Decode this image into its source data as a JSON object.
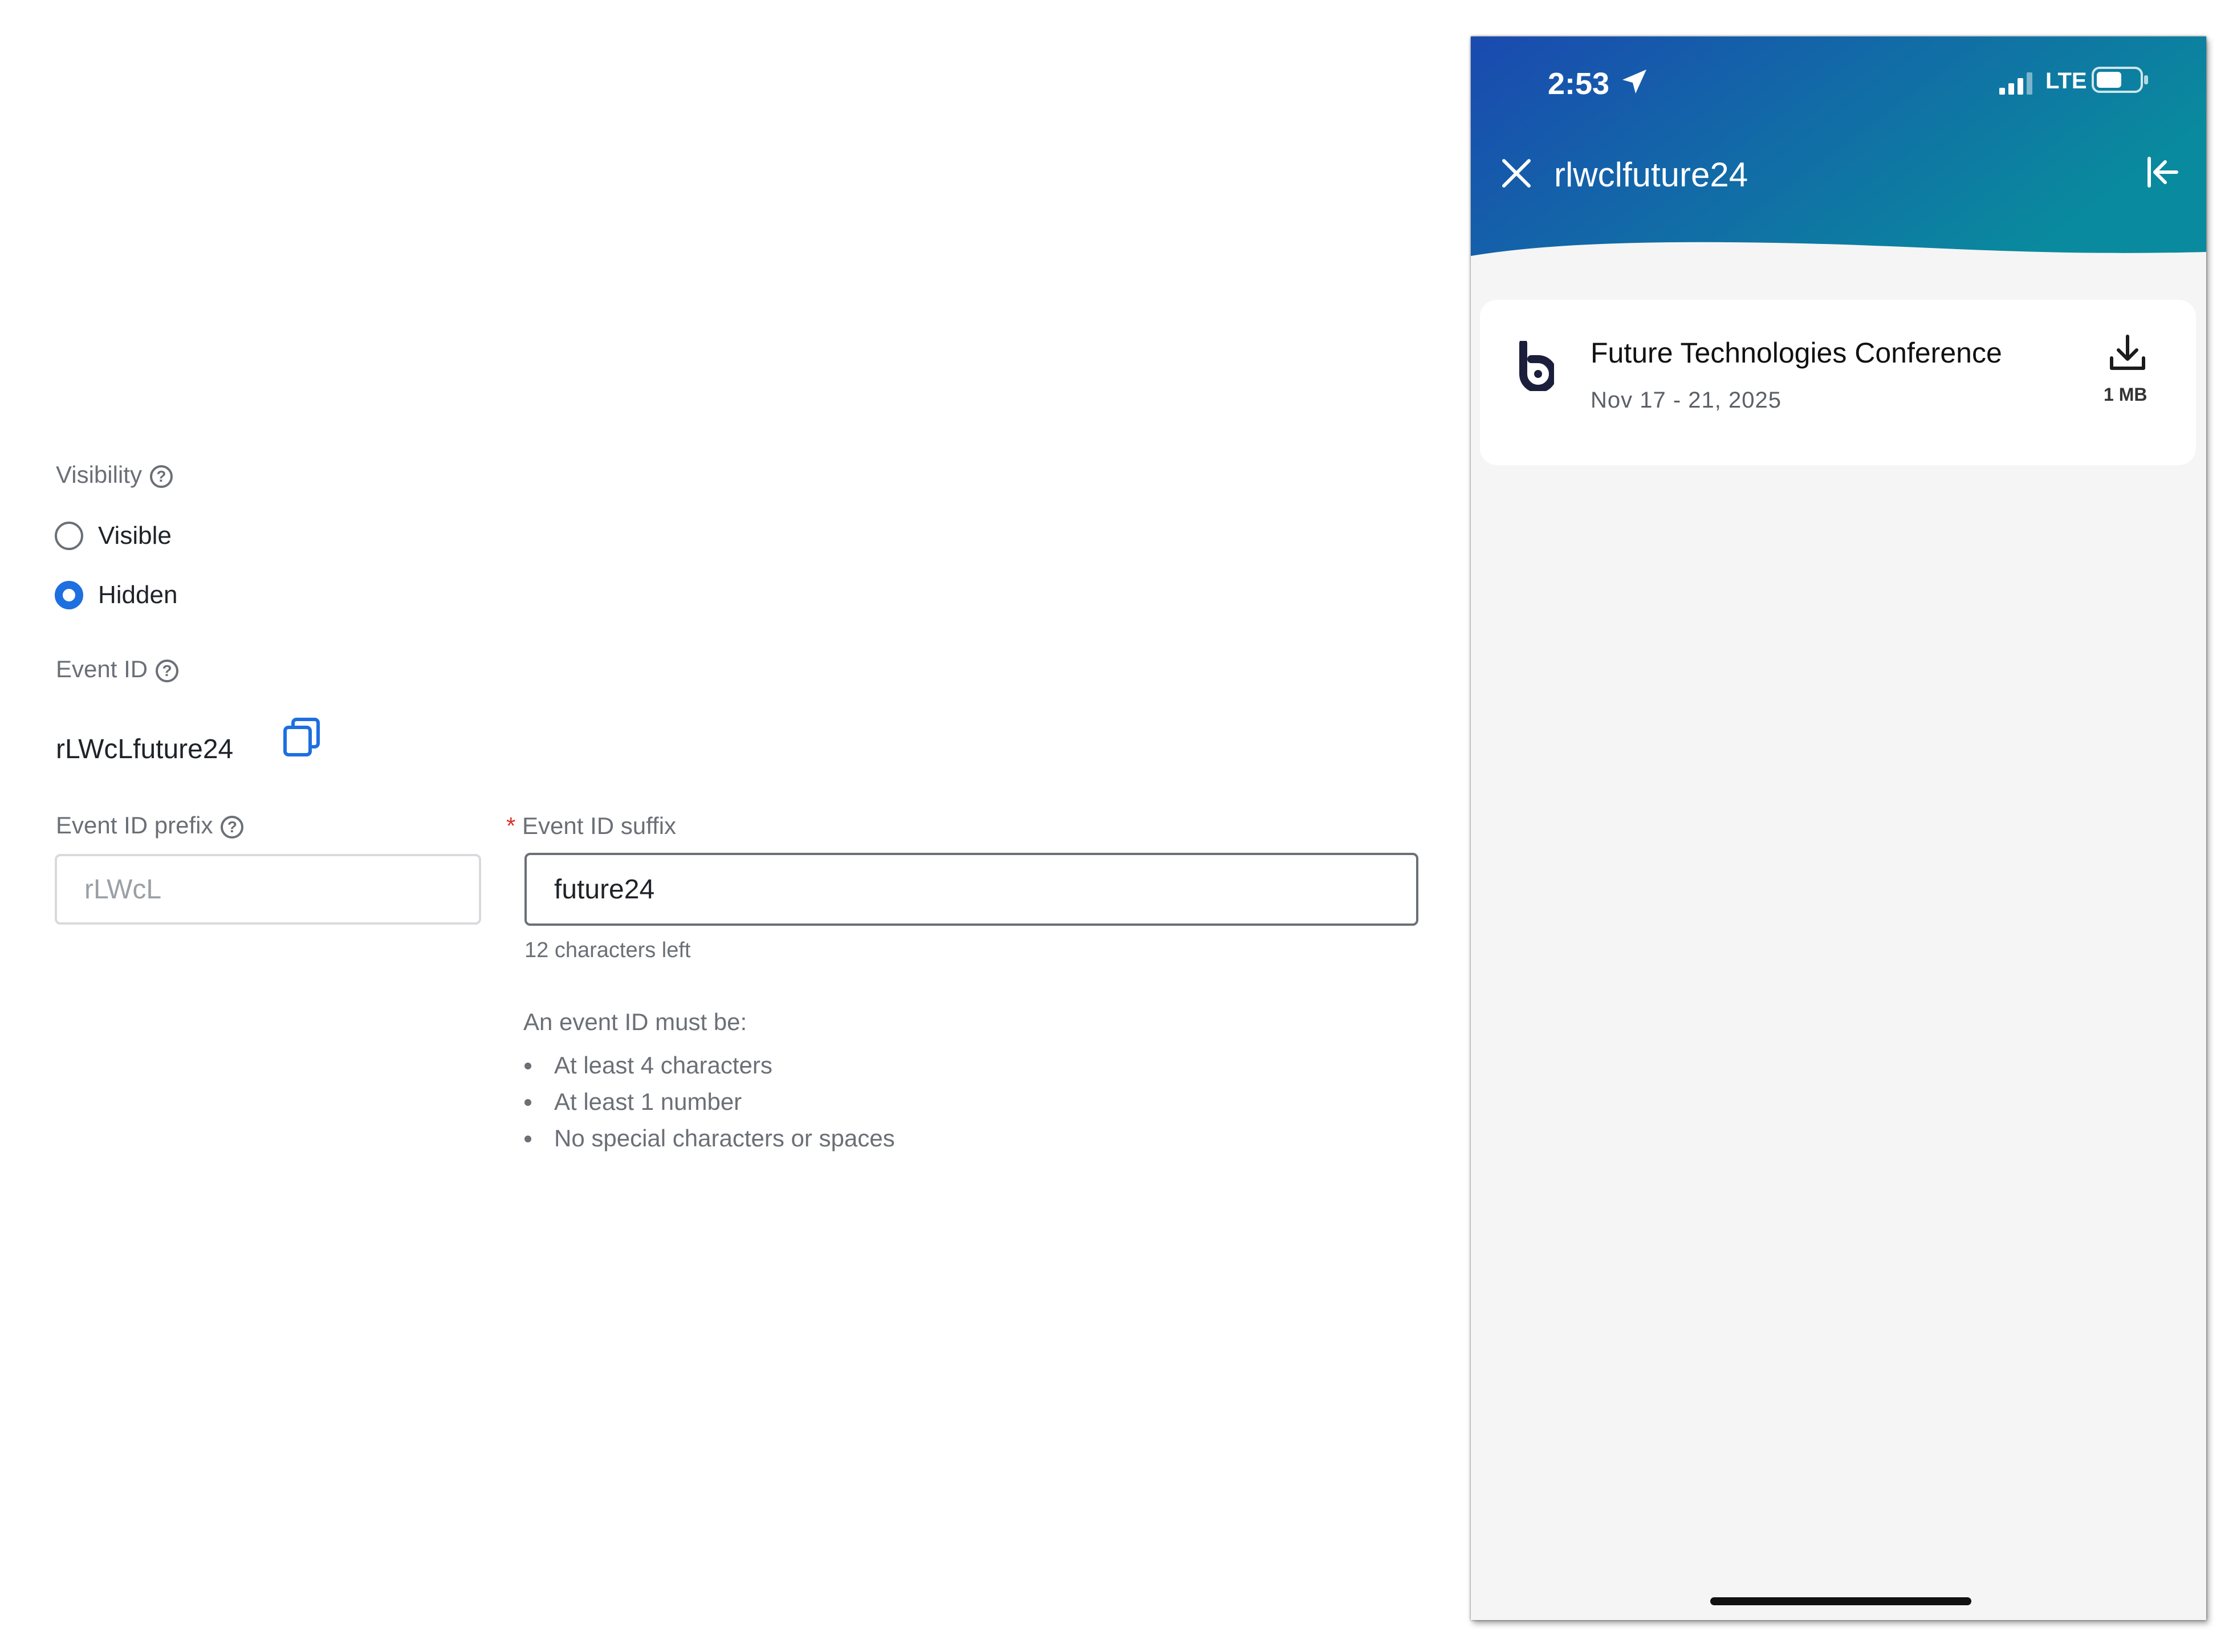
{
  "form": {
    "visibility_label": "Visibility",
    "visibility_options": [
      {
        "label": "Visible",
        "selected": false
      },
      {
        "label": "Hidden",
        "selected": true
      }
    ],
    "event_id_label": "Event ID",
    "event_id_value": "rLWcLfuture24",
    "prefix_label": "Event ID prefix",
    "prefix_value": "rLWcL",
    "suffix_required_mark": "*",
    "suffix_label": "Event ID suffix",
    "suffix_value": "future24",
    "chars_left": "12 characters left",
    "rules_title": "An event ID must be:",
    "rules": [
      "At least 4 characters",
      "At least 1 number",
      "No special characters or spaces"
    ],
    "help_glyph": "?",
    "accent_color": "#1e6fe0"
  },
  "phone": {
    "status": {
      "time": "2:53",
      "network": "LTE",
      "battery_level": 0.6
    },
    "header": {
      "search_query": "rlwclfuture24",
      "gradient_colors": [
        "#1a4ab0",
        "#0a8a9e"
      ]
    },
    "result": {
      "title": "Future Technologies Conference",
      "dates": "Nov 17 - 21, 2025",
      "size": "1 MB"
    }
  }
}
